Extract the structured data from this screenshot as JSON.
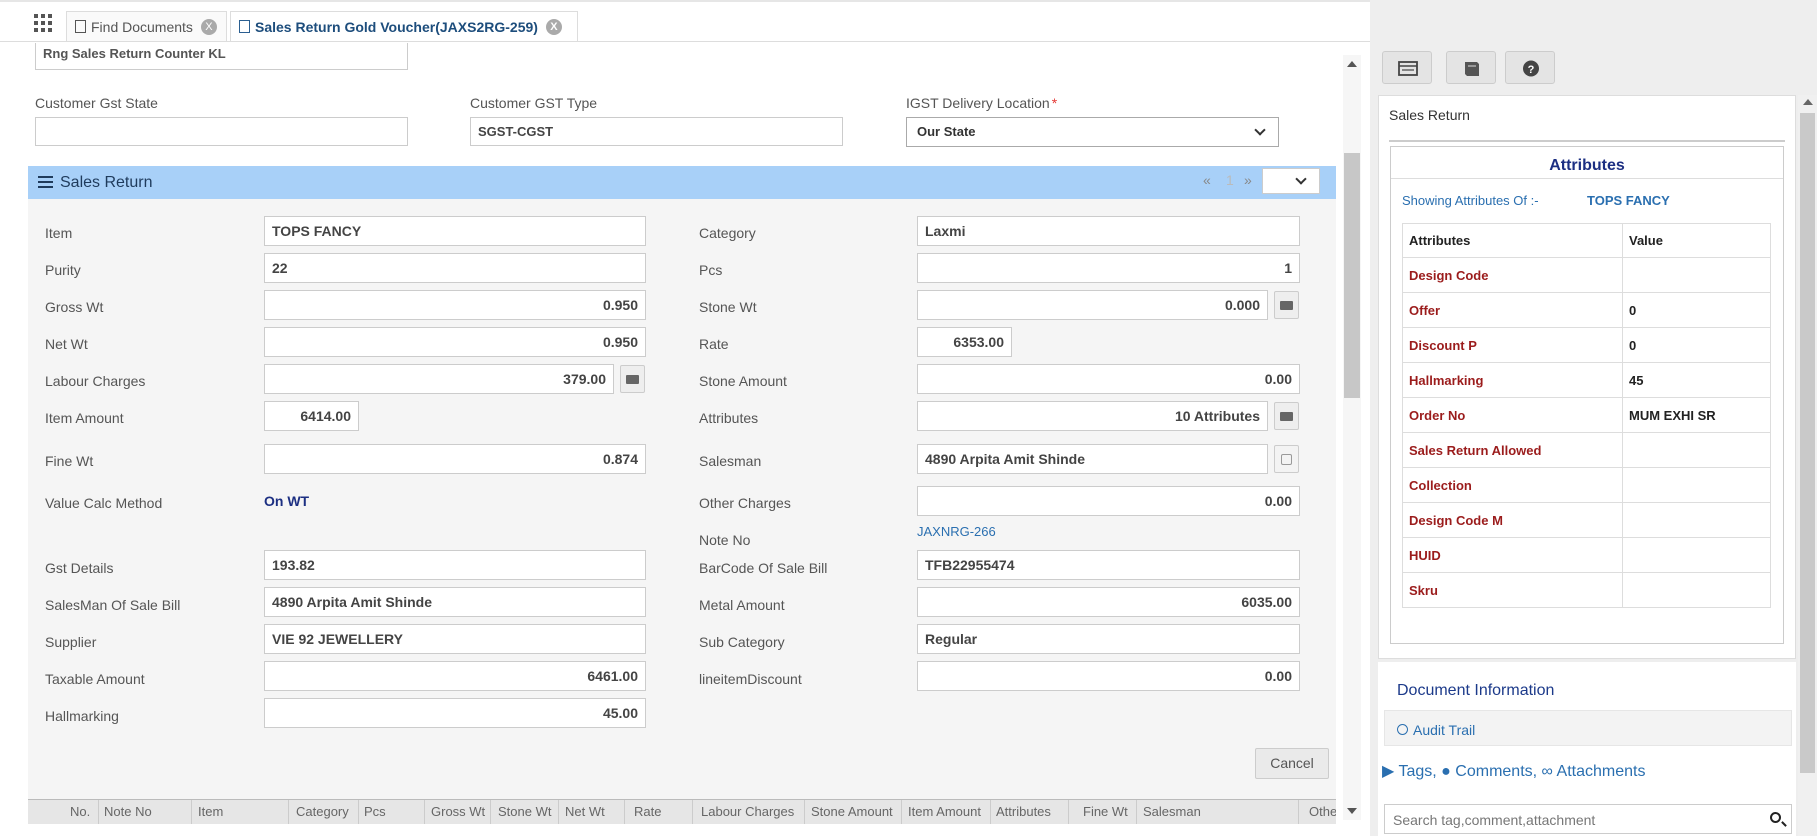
{
  "tabs": [
    {
      "label": "Find Documents"
    },
    {
      "label": "Sales Return Gold Voucher(JAXS2RG-259)"
    }
  ],
  "header": {
    "top_partial_value": "Rng Sales Return Counter KL",
    "customer_gst_state_label": "Customer Gst State",
    "customer_gst_state_value": "",
    "customer_gst_type_label": "Customer GST Type",
    "customer_gst_type_value": "SGST-CGST",
    "igst_delivery_label": "IGST Delivery Location",
    "igst_delivery_value": "Our State"
  },
  "section": {
    "title": "Sales Return",
    "pager": {
      "prev": "«",
      "page": "1",
      "next": "»"
    }
  },
  "left_fields": [
    {
      "label": "Item",
      "value": "TOPS FANCY"
    },
    {
      "label": "Purity",
      "value": "22"
    },
    {
      "label": "Gross Wt",
      "value": "0.950"
    },
    {
      "label": "Net Wt",
      "value": "0.950"
    },
    {
      "label": "Labour Charges",
      "value": "379.00"
    },
    {
      "label": "Item Amount",
      "value": "6414.00"
    },
    {
      "label": "Fine Wt",
      "value": "0.874"
    },
    {
      "label": "Value Calc Method",
      "value": "On WT"
    },
    {
      "label": "Gst Details",
      "value": "193.82"
    },
    {
      "label": "SalesMan Of Sale Bill",
      "value": "4890 Arpita Amit Shinde"
    },
    {
      "label": "Supplier",
      "value": "VIE 92 JEWELLERY"
    },
    {
      "label": "Taxable Amount",
      "value": "6461.00"
    },
    {
      "label": "Hallmarking",
      "value": "45.00"
    }
  ],
  "right_fields": [
    {
      "label": "Category",
      "value": "Laxmi"
    },
    {
      "label": "Pcs",
      "value": "1"
    },
    {
      "label": "Stone Wt",
      "value": "0.000"
    },
    {
      "label": "Rate",
      "value": "6353.00"
    },
    {
      "label": "Stone Amount",
      "value": "0.00"
    },
    {
      "label": "Attributes",
      "value": "10 Attributes"
    },
    {
      "label": "Salesman",
      "value": "4890 Arpita Amit Shinde"
    },
    {
      "label": "Other Charges",
      "value": "0.00"
    },
    {
      "label": "Note No",
      "value": "JAXNRG-266"
    },
    {
      "label": "BarCode Of Sale Bill",
      "value": "TFB22955474"
    },
    {
      "label": "Metal Amount",
      "value": "6035.00"
    },
    {
      "label": "Sub Category",
      "value": "Regular"
    },
    {
      "label": "lineitemDiscount",
      "value": "0.00"
    }
  ],
  "cancel_label": "Cancel",
  "grid_columns": [
    "No.",
    "Note No",
    "Item",
    "Category",
    "Pcs",
    "Gross Wt",
    "Stone Wt",
    "Net Wt",
    "Rate",
    "Labour Charges",
    "Stone Amount",
    "Item Amount",
    "Attributes",
    "Fine Wt",
    "Salesman",
    "Othe"
  ],
  "side": {
    "title": "Sales Return",
    "attributes_heading": "Attributes",
    "showing_label": "Showing Attributes Of :-",
    "showing_value": "TOPS FANCY",
    "col_attr": "Attributes",
    "col_value": "Value",
    "rows": [
      {
        "k": "Design Code",
        "v": ""
      },
      {
        "k": "Offer",
        "v": "0"
      },
      {
        "k": "Discount P",
        "v": "0"
      },
      {
        "k": "Hallmarking",
        "v": "45"
      },
      {
        "k": "Order No",
        "v": "MUM EXHI SR"
      },
      {
        "k": "Sales Return Allowed",
        "v": ""
      },
      {
        "k": "Collection",
        "v": ""
      },
      {
        "k": "Design Code M",
        "v": ""
      },
      {
        "k": "HUID",
        "v": ""
      },
      {
        "k": "Skru",
        "v": ""
      }
    ],
    "doc_info_title": "Document Information",
    "audit_trail": "Audit Trail",
    "tags": "Tags,",
    "comments": "Comments,",
    "attachments": "Attachments",
    "search_placeholder": "Search tag,comment,attachment"
  },
  "colors": {
    "header_band": "#a8d0f8",
    "link": "#2a6fb0",
    "attr_key": "#9b1c1c"
  },
  "icons": [
    "apps-grid-icon",
    "document-icon",
    "close-icon",
    "list-icon",
    "folder-open-icon",
    "edit-icon",
    "chevron-down-icon",
    "table-icon",
    "book-icon",
    "question-icon",
    "history-icon",
    "tag-icon",
    "comments-icon",
    "paperclip-icon",
    "search-icon"
  ]
}
